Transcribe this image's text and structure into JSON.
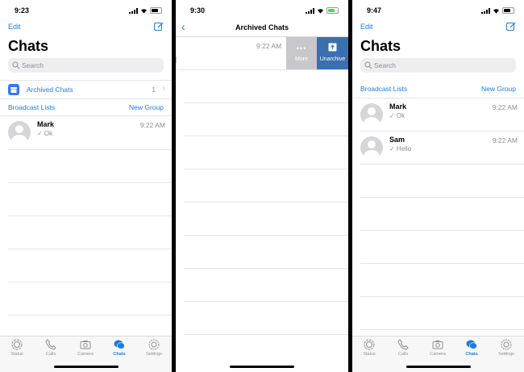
{
  "screen1": {
    "time": "9:23",
    "edit_label": "Edit",
    "title": "Chats",
    "search_placeholder": "Search",
    "archived": {
      "label": "Archived Chats",
      "count": "1"
    },
    "broadcast_label": "Broadcast Lists",
    "new_group_label": "New Group",
    "chats": [
      {
        "name": "Mark",
        "time": "9:22 AM",
        "message": "✓ Ok"
      }
    ]
  },
  "screen2": {
    "time": "9:30",
    "title": "Archived Chats",
    "row_time": "9:22 AM",
    "more_label": "More",
    "unarchive_label": "Unarchive"
  },
  "screen3": {
    "time": "9:47",
    "edit_label": "Edit",
    "title": "Chats",
    "search_placeholder": "Search",
    "broadcast_label": "Broadcast Lists",
    "new_group_label": "New Group",
    "chats": [
      {
        "name": "Mark",
        "time": "9:22 AM",
        "message": "✓ Ok"
      },
      {
        "name": "Sam",
        "time": "9:22 AM",
        "message": "✓ Hello"
      }
    ]
  },
  "tabbar": {
    "tabs": [
      "Status",
      "Calls",
      "Camera",
      "Chats",
      "Settings"
    ],
    "active": "Chats"
  },
  "colors": {
    "accent": "#1e7be0",
    "unarchive": "#3a6fb0",
    "more": "#c7c7cc"
  }
}
